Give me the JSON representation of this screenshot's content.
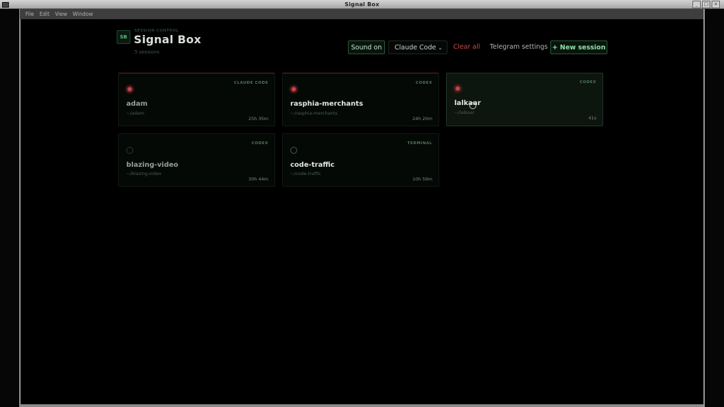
{
  "window": {
    "title": "Signal Box",
    "controls": [
      "_",
      "□",
      "×"
    ]
  },
  "menu": [
    "File",
    "Edit",
    "View",
    "Window"
  ],
  "header": {
    "badge": "SB",
    "eyebrow": "SESSION CONTROL",
    "title": "Signal Box",
    "session_count": "5 sessions"
  },
  "toolbar": {
    "sound_label": "Sound on",
    "agent_select_value": "Claude Code",
    "clear_label": "Clear all",
    "telegram_label": "Telegram settings",
    "new_session_label": "+ New session"
  },
  "sessions": [
    {
      "name": "adam",
      "path": "~/adam",
      "agent": "CLAUDE CODE",
      "duration": "25h 35m",
      "status": "alert"
    },
    {
      "name": "rasphia-merchants",
      "path": "~/rasphia-merchants",
      "agent": "CODEX",
      "duration": "24h 20m",
      "status": "alert"
    },
    {
      "name": "lalkaar",
      "path": "~/lalkaar",
      "agent": "CODEX",
      "duration": "41s",
      "status": "alert"
    },
    {
      "name": "blazing-video",
      "path": "~/blazing-video",
      "agent": "CODEX",
      "duration": "30h 44m",
      "status": "idle"
    },
    {
      "name": "code-traffic",
      "path": "~/code-traffic",
      "agent": "TERMINAL",
      "duration": "10h 59m",
      "status": "idle"
    }
  ],
  "colors": {
    "accent_green": "#8fe0a6",
    "alert_red": "#c04a4a",
    "background": "#000000"
  }
}
